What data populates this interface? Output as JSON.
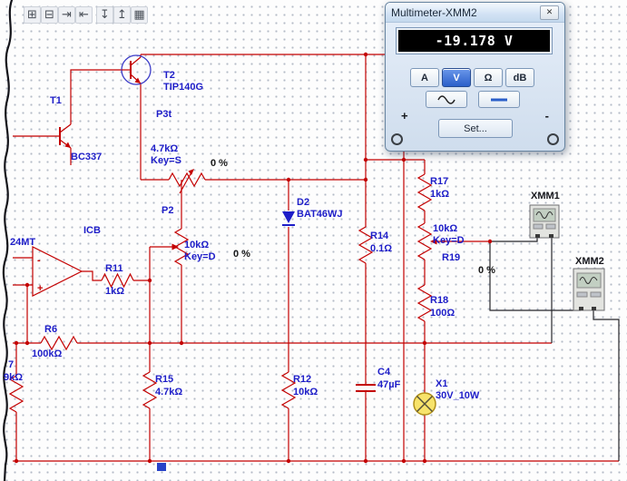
{
  "toolbar": {
    "icons": [
      {
        "name": "hierarchy-icon",
        "glyph": "⊞"
      },
      {
        "name": "flatten-icon",
        "glyph": "⊟"
      },
      {
        "name": "indent-icon",
        "glyph": "⇥"
      },
      {
        "name": "outdent-icon",
        "glyph": "⇤"
      },
      {
        "name": "move-down-icon",
        "glyph": "↧"
      },
      {
        "name": "move-up-icon",
        "glyph": "↥"
      },
      {
        "name": "grid-icon",
        "glyph": "▦"
      }
    ]
  },
  "multimeter": {
    "title": "Multimeter-XMM2",
    "close_glyph": "✕",
    "reading": "-19.178 V",
    "modes": [
      {
        "label": "A",
        "selected": false
      },
      {
        "label": "V",
        "selected": true
      },
      {
        "label": "Ω",
        "selected": false
      },
      {
        "label": "dB",
        "selected": false
      }
    ],
    "wave_modes": [
      {
        "icon": "sine-wave-icon",
        "selected": false
      },
      {
        "icon": "dc-line-icon",
        "selected": true
      }
    ],
    "terminals": {
      "plus": "+",
      "minus": "-"
    },
    "set_label": "Set..."
  },
  "components": {
    "t2": {
      "ref": "T2",
      "value": "TIP140G"
    },
    "t1": {
      "ref": "T1",
      "value": "BC337"
    },
    "p3": {
      "ref": "P3t"
    },
    "p1": {
      "value": "4.7kΩ",
      "key": "Key=S",
      "percent": "0 %"
    },
    "p2": {
      "ref": "P2",
      "value": "10kΩ",
      "key": "Key=D",
      "percent": "0 %"
    },
    "d2": {
      "ref": "D2",
      "value": "BAT46WJ"
    },
    "r14": {
      "ref": "R14",
      "value": "0.1Ω"
    },
    "r17": {
      "ref": "R17",
      "value": "1kΩ"
    },
    "r19": {
      "ref": "R19",
      "value": "10kΩ",
      "key": "Key=D",
      "percent": "0 %"
    },
    "r18": {
      "ref": "R18",
      "value": "100Ω"
    },
    "opamp": {
      "ref": "ICB",
      "value": "24MT"
    },
    "r11": {
      "ref": "R11",
      "value": "1kΩ"
    },
    "r6": {
      "ref": "R6",
      "value": "100kΩ"
    },
    "r7": {
      "ref": "7",
      "value": "9kΩ"
    },
    "r15": {
      "ref": "R15",
      "value": "4.7kΩ"
    },
    "r12": {
      "ref": "R12",
      "value": "10kΩ"
    },
    "c4": {
      "ref": "C4",
      "value": "47µF"
    },
    "x1": {
      "ref": "X1",
      "value": "30V_10W"
    },
    "xmm1": {
      "ref": "XMM1"
    },
    "xmm2": {
      "ref": "XMM2"
    }
  },
  "colors": {
    "wire": "#c40000",
    "component_label": "#1d1dc8",
    "selected_button": "#2b5fc9",
    "display_bg": "#000000",
    "display_text": "#ffffff",
    "lamp_fill": "#f7e36b"
  }
}
